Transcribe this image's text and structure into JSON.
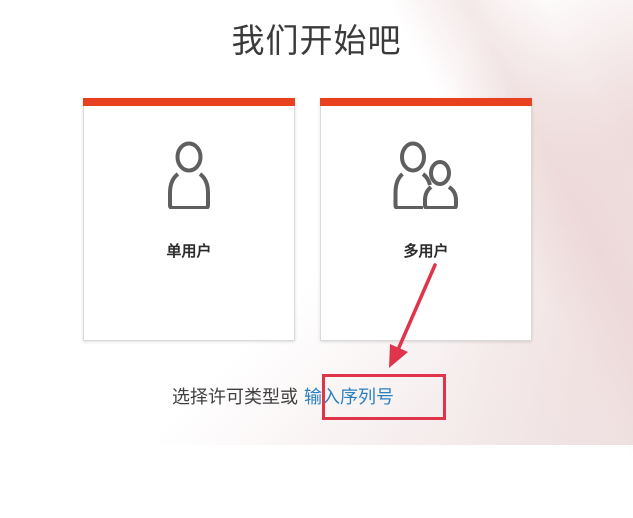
{
  "page": {
    "title": "我们开始吧"
  },
  "cards": {
    "single_user": {
      "label": "单用户",
      "icon": "user-icon"
    },
    "multi_user": {
      "label": "多用户",
      "icon": "users-icon"
    }
  },
  "footer": {
    "prompt_text": "选择许可类型或",
    "serial_link_label": "输入序列号"
  },
  "annotation": {
    "highlight_color": "#e0344a",
    "accent_color": "#e8411f",
    "link_color": "#2a7fc1"
  }
}
